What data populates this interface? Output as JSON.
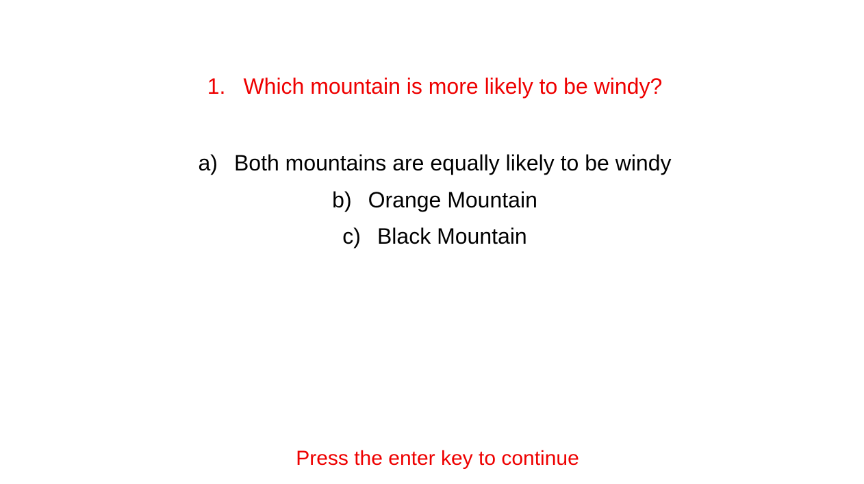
{
  "colors": {
    "question": "#ee0000",
    "options": "#000000",
    "footer": "#ee0000",
    "background": "#ffffff"
  },
  "question": {
    "number": "1.",
    "text": "Which mountain is more likely to be windy?"
  },
  "options": [
    {
      "letter": "a)",
      "text": "Both mountains are equally likely to be windy"
    },
    {
      "letter": "b)",
      "text": "Orange Mountain"
    },
    {
      "letter": "c)",
      "text": "Black Mountain"
    }
  ],
  "footer": {
    "text": "Press the enter key to continue"
  }
}
